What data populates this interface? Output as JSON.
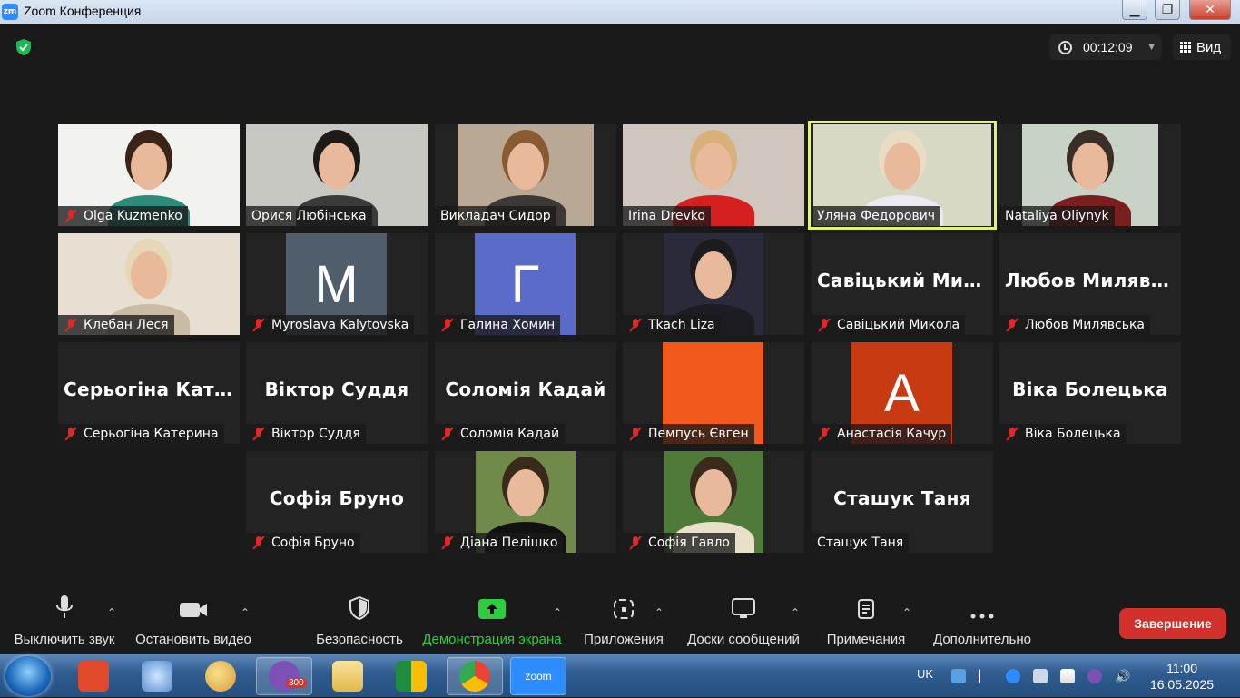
{
  "window": {
    "title": "Zoom Конференция",
    "app_badge": "zm"
  },
  "top": {
    "timer": "00:12:09",
    "view_label": "Вид"
  },
  "participants": [
    {
      "name": "Olga Kuzmenko",
      "muted": true,
      "kind": "video",
      "bg": "#f2f2ef",
      "shirt": "#2e8b7a",
      "hair": "#3a2418"
    },
    {
      "name": "Орися Любінська",
      "muted": false,
      "kind": "video",
      "bg": "#c8c8c2",
      "shirt": "#3a3a3a",
      "hair": "#1e1a18"
    },
    {
      "name": "Викладач Сидор",
      "muted": false,
      "kind": "video",
      "bg": "#b9a994",
      "shirt": "#3c3835",
      "hair": "#8a5a32"
    },
    {
      "name": "Irina Drevko",
      "muted": false,
      "kind": "video",
      "bg": "#cfc7bd",
      "shirt": "#d62020",
      "hair": "#d9b07a"
    },
    {
      "name": "Уляна Федорович",
      "muted": false,
      "kind": "video",
      "active": true,
      "bg": "#d7d9c5",
      "shirt": "#eaeaf0",
      "hair": "#e8dcc5"
    },
    {
      "name": "Nataliya Oliynyk",
      "muted": false,
      "kind": "video",
      "bg": "#c9d2c6",
      "shirt": "#7a1f1f",
      "hair": "#3a2e28"
    },
    {
      "name": "Клебан Леся",
      "muted": true,
      "kind": "video",
      "bg": "#e6dfd2",
      "shirt": "#c9bba4",
      "hair": "#e6d8b6"
    },
    {
      "name": "Myroslava Kalytovska",
      "muted": true,
      "kind": "avatar",
      "letter": "M",
      "color": "#4f5e6a"
    },
    {
      "name": "Галина Хомин",
      "muted": true,
      "kind": "avatar",
      "letter": "Г",
      "color": "#5b6bc8"
    },
    {
      "name": "Tkach Liza",
      "muted": true,
      "kind": "video",
      "bg": "#2a2a3a",
      "shirt": "#1c1c22",
      "hair": "#1c1c1c"
    },
    {
      "name": "Савіцький Микола",
      "muted": true,
      "kind": "name",
      "display": "Савіцький Мик…"
    },
    {
      "name": "Любов Милявська",
      "muted": true,
      "kind": "name",
      "display": "Любов Милявс…"
    },
    {
      "name": "Серьогіна Катерина",
      "muted": true,
      "kind": "name",
      "display": "Серьогіна Кате…"
    },
    {
      "name": "Віктор Суддя",
      "muted": true,
      "kind": "name",
      "display": "Віктор Суддя"
    },
    {
      "name": "Соломія Кадай",
      "muted": true,
      "kind": "name",
      "display": "Соломія Кадай"
    },
    {
      "name": "Пемпусь Євген",
      "muted": true,
      "kind": "avatar",
      "letter": "",
      "color": "#f25a1d"
    },
    {
      "name": "Анастасія Качур",
      "muted": true,
      "kind": "avatar",
      "letter": "A",
      "color": "#c83a12"
    },
    {
      "name": "Віка Болецька",
      "muted": true,
      "kind": "name",
      "display": "Віка Болецька"
    },
    {
      "name": "Софія Бруно",
      "muted": true,
      "kind": "name",
      "display": "Софія Бруно"
    },
    {
      "name": "Діана Пелішко",
      "muted": true,
      "kind": "video",
      "bg": "#6f8a4a",
      "shirt": "#111111",
      "hair": "#3a2a1a"
    },
    {
      "name": "Софія Гавло",
      "muted": true,
      "kind": "video",
      "bg": "#4f7a3a",
      "shirt": "#e8e0c8",
      "hair": "#3a2a1a"
    },
    {
      "name": "Сташук Таня",
      "muted": false,
      "kind": "name",
      "display": "Сташук Таня"
    }
  ],
  "toolbar": {
    "mute": "Выключить звук",
    "video": "Остановить видео",
    "security": "Безопасность",
    "share": "Демонстрация экрана",
    "apps": "Приложения",
    "whiteboards": "Доски сообщений",
    "notes": "Примечания",
    "more": "Дополнительно",
    "end": "Завершение"
  },
  "taskbar": {
    "viber_badge": "300",
    "zoom_label": "zoom",
    "lang": "UK",
    "time": "11:00",
    "date": "16.05.2025"
  },
  "colors": {
    "accent_green": "#2ecc40",
    "end_red": "#d2302a",
    "active_outline": "#e6f26a"
  }
}
